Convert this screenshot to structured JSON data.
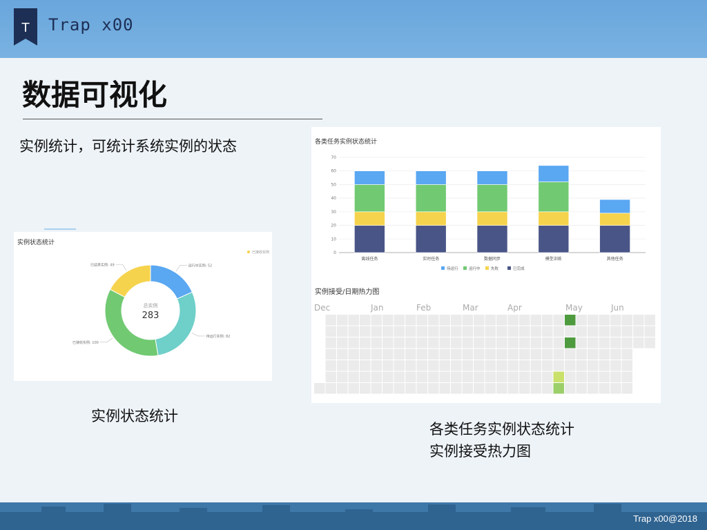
{
  "header": {
    "logo_letter": "T",
    "brand": "Trap x00"
  },
  "slide": {
    "title": "数据可视化",
    "intro": "实例统计，可统计系统实例的状态",
    "caption_left": "实例状态统计",
    "caption_right_line1": "各类任务实例状态统计",
    "caption_right_line2": "实例接受热力图"
  },
  "footer": {
    "text": "Trap x00@2018"
  },
  "colors": {
    "blue": "#5aa7f2",
    "green": "#71c972",
    "yellow": "#f5d34c",
    "navy": "#4a5587",
    "teal": "#6fcfc9",
    "heat_dark": "#4e9b3f",
    "heat_light1": "#c9e06b",
    "heat_light2": "#9ccf6a",
    "empty": "#ebebeb"
  },
  "chart_data": [
    {
      "type": "pie",
      "title": "实例状态统计",
      "legend": "已接收实例",
      "center_label": "总实例",
      "center_value": "283",
      "slices": [
        {
          "label": "运行中实例: 52",
          "value": 52,
          "color": "#5aa7f2"
        },
        {
          "label": "待运行实例: 82",
          "value": 82,
          "color": "#6fcfc9"
        },
        {
          "label": "已接收实例: 100",
          "value": 100,
          "color": "#71c972"
        },
        {
          "label": "已结束实例: 49",
          "value": 49,
          "color": "#f5d34c"
        }
      ]
    },
    {
      "type": "bar",
      "title": "各类任务实例状态统计",
      "categories": [
        "离线任务",
        "实时任务",
        "数据同步",
        "模型训练",
        "其他任务"
      ],
      "ylim": [
        0,
        70
      ],
      "yticks": [
        0,
        10,
        20,
        30,
        40,
        50,
        60,
        70
      ],
      "series": [
        {
          "name": "已完成",
          "color": "#4a5587",
          "values": [
            20,
            20,
            20,
            20,
            20
          ]
        },
        {
          "name": "失败",
          "color": "#f5d34c",
          "values": [
            10,
            10,
            10,
            10,
            9
          ]
        },
        {
          "name": "运行中",
          "color": "#71c972",
          "values": [
            20,
            20,
            20,
            22,
            0
          ]
        },
        {
          "name": "待运行",
          "color": "#5aa7f2",
          "values": [
            10,
            10,
            10,
            12,
            10
          ]
        }
      ]
    },
    {
      "type": "heatmap",
      "title": "实例接受/日期热力图",
      "months": [
        "Dec",
        "Jan",
        "Feb",
        "Mar",
        "Apr",
        "May",
        "Jun"
      ],
      "columns": 30,
      "rows": 7,
      "cells": [
        {
          "col": 22,
          "row": 0,
          "level": 3
        },
        {
          "col": 22,
          "row": 2,
          "level": 3
        },
        {
          "col": 21,
          "row": 5,
          "level": 1
        },
        {
          "col": 21,
          "row": 6,
          "level": 2
        }
      ]
    }
  ]
}
